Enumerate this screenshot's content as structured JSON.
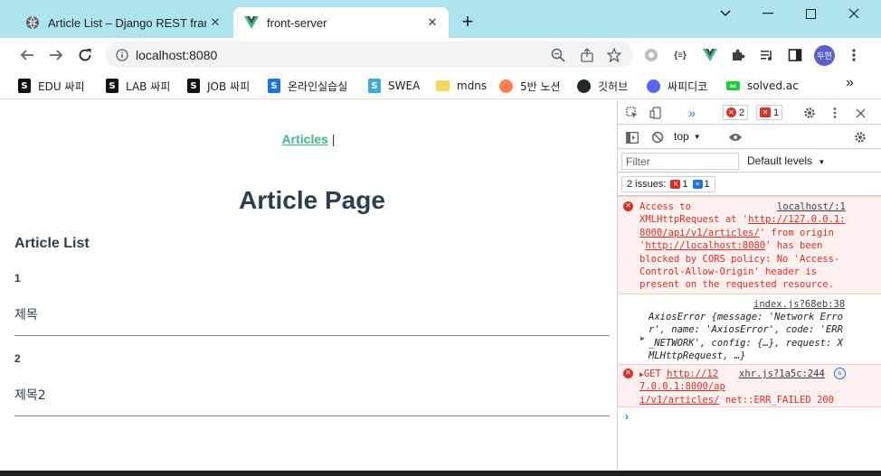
{
  "browser": {
    "tabs": [
      {
        "title": "Article List – Django REST frame",
        "favicon": "globe-icon",
        "active": false
      },
      {
        "title": "front-server",
        "favicon": "vue-icon",
        "active": true
      }
    ],
    "new_tab_label": "+",
    "url": "localhost:8080",
    "profile_name": "두현",
    "bookmarks": [
      {
        "label": "EDU 싸피",
        "icon": "ssafy-icon",
        "color": "#111111"
      },
      {
        "label": "LAB 싸피",
        "icon": "ssafy-icon",
        "color": "#111111"
      },
      {
        "label": "JOB 싸피",
        "icon": "ssafy-icon",
        "color": "#111111"
      },
      {
        "label": "온라인실습실",
        "icon": "ssafy-online-icon",
        "color": "#1a73e8"
      },
      {
        "label": "SWEA",
        "icon": "swea-icon",
        "color": "#3fa9e0"
      },
      {
        "label": "mdns",
        "icon": "folder-icon",
        "color": "#f9d65c"
      },
      {
        "label": "5반 노션",
        "icon": "peach-icon",
        "color": "#ff7f50"
      },
      {
        "label": "깃허브",
        "icon": "github-icon",
        "color": "#24292e"
      },
      {
        "label": "싸피디코",
        "icon": "discord-icon",
        "color": "#5865f2"
      },
      {
        "label": "solved.ac",
        "icon": "solvedac-icon",
        "color": "#17ce3a"
      }
    ],
    "bookmarks_more": "»"
  },
  "page": {
    "nav_link": "Articles",
    "nav_separator": "|",
    "heading": "Article Page",
    "list_heading": "Article List",
    "articles": [
      {
        "id": "1",
        "title": "제목"
      },
      {
        "id": "2",
        "title": "제목2"
      }
    ]
  },
  "devtools": {
    "panel_chevron": "»",
    "error_count": "2",
    "issue_count": "1",
    "context": "top",
    "filter_placeholder": "Filter",
    "levels_label": "Default levels",
    "issues_label": "2 issues:",
    "issues_error_count": "1",
    "issues_info_count": "1",
    "messages": {
      "cors_source": "localhost/:1",
      "cors_l1": "Access to",
      "cors_l2a": "XMLHttpRequest at '",
      "cors_l2b": "http://127.0.0.1:",
      "cors_l3a": "8000/api/v1/articles/",
      "cors_l3b": "' from origin",
      "cors_l4a": "'",
      "cors_l4b": "http://localhost:8080",
      "cors_l4c": "' has been",
      "cors_l5": "blocked by CORS policy: No 'Access-",
      "cors_l6": "Control-Allow-Origin' header is",
      "cors_l7": "present on the requested resource.",
      "axios_source": "index.js?68eb:38",
      "axios_l1": "AxiosError {message: 'Network Erro",
      "axios_l2": "r', name: 'AxiosError', code: 'ERR",
      "axios_l3": "_NETWORK', config: {…}, request: X",
      "axios_l4": "MLHttpRequest, …}",
      "get_method": "GET",
      "get_url_l1": "http://12",
      "get_url_l2": "7.0.0.1:8000/ap",
      "get_url_l3": "i/v1/articles/",
      "get_status": " net::ERR_FAILED 200",
      "get_source": "xhr.js?1a5c:244"
    },
    "prompt": "›"
  },
  "colors": {
    "titlebar": "#aee4f0",
    "accent_link": "#42b983",
    "text": "#2c3e50",
    "error": "#d93025",
    "profile": "#5b61c9"
  }
}
